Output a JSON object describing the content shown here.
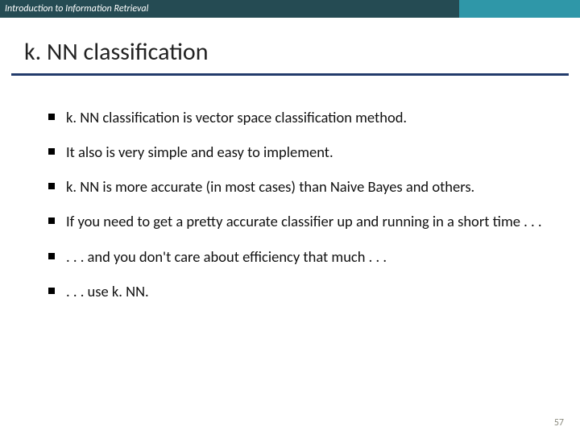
{
  "header": {
    "title": "Introduction to Information Retrieval"
  },
  "slide": {
    "title": "k. NN classification",
    "bullets": [
      "k. NN classification is vector space classification method.",
      "It also is very simple and easy to implement.",
      "k. NN is more accurate (in most cases) than Naive Bayes and others.",
      "If you need to get a pretty accurate classifier up and running in a short time . . .",
      ". . . and you don't care about efficiency that much . . .",
      ". . . use k. NN."
    ],
    "page_number": "57"
  }
}
